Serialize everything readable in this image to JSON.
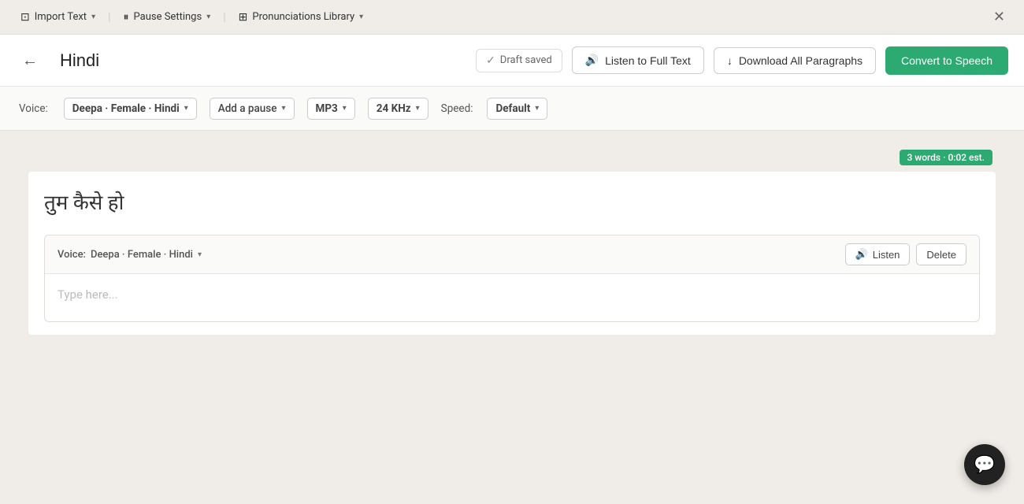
{
  "nav": {
    "import_text": "Import Text",
    "pause_settings": "Pause Settings",
    "pronunciations_library": "Pronunciations Library",
    "import_icon": "⊡",
    "pause_icon": "⏸",
    "lib_icon": "⊞",
    "arrow": "▾",
    "close_icon": "✕"
  },
  "header": {
    "back_icon": "←",
    "title": "Hindi",
    "draft_label": "Draft saved",
    "draft_icon": "✓",
    "listen_label": "Listen to Full Text",
    "listen_icon": "🔊",
    "download_label": "Download All Paragraphs",
    "download_icon": "↓",
    "convert_label": "Convert to Speech"
  },
  "toolbar": {
    "voice_prefix": "Voice:",
    "voice_value": "Deepa · Female · Hindi",
    "voice_arrow": "▾",
    "pause_label": "Add a pause",
    "pause_arrow": "▾",
    "format_label": "MP3",
    "format_arrow": "▾",
    "quality_label": "24 KHz",
    "quality_arrow": "▾",
    "speed_prefix": "Speed:",
    "speed_value": "Default",
    "speed_arrow": "▾"
  },
  "word_count": {
    "badge": "3 words · 0:02 est."
  },
  "main_paragraph": {
    "text": "तुम कैसे हो"
  },
  "para_block": {
    "voice_prefix": "Voice:",
    "voice_value": "Deepa · Female · Hindi",
    "voice_arrow": "▾",
    "listen_label": "Listen",
    "listen_icon": "🔊",
    "delete_label": "Delete",
    "placeholder": "Type here..."
  },
  "chat": {
    "icon": "💬"
  }
}
